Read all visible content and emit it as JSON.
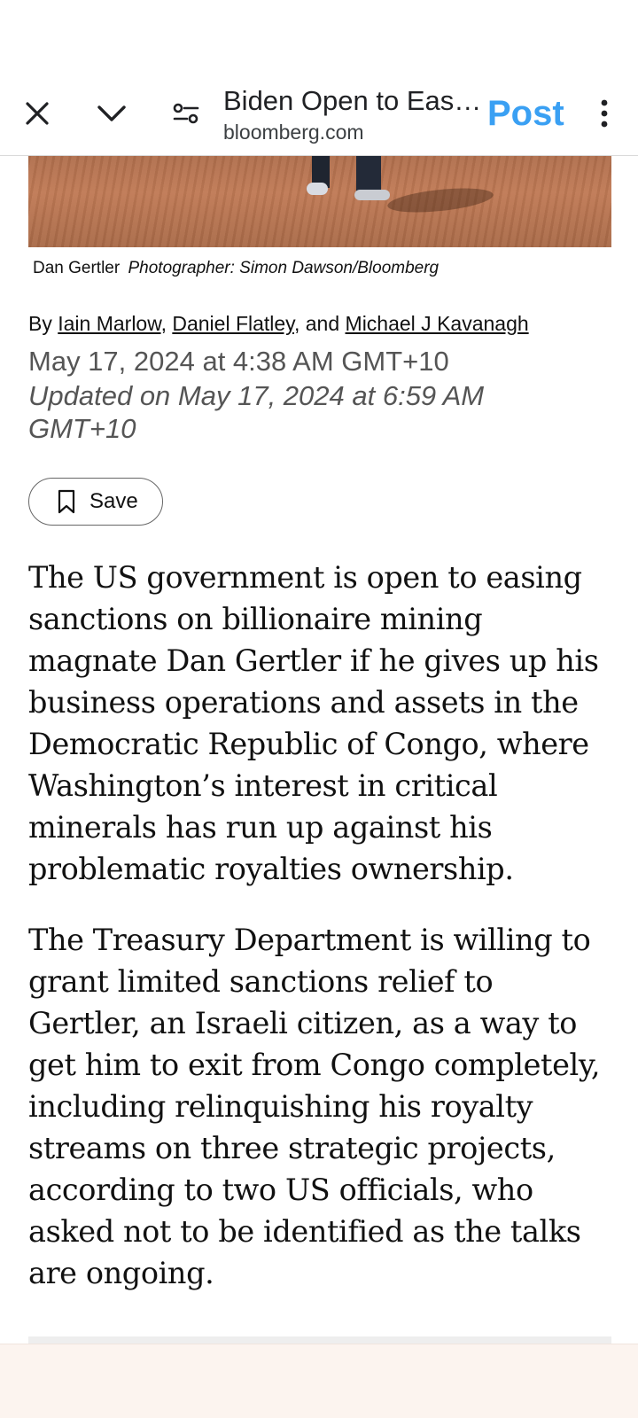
{
  "toolbar": {
    "title": "Biden Open to Easi...",
    "domain": "bloomberg.com",
    "post_label": "Post",
    "icons": [
      "close-icon",
      "chevron-down-icon",
      "page-settings-icon",
      "more-vert-icon"
    ],
    "accent_color": "#3aa0f3"
  },
  "photo": {
    "caption_name": "Dan Gertler",
    "caption_credit": "Photographer: Simon Dawson/Bloomberg"
  },
  "byline": {
    "prefix": "By",
    "authors": [
      "Iain Marlow",
      "Daniel Flatley",
      "Michael J Kavanagh"
    ],
    "sep1": ",",
    "sep2": ", and"
  },
  "dates": {
    "published": "May 17, 2024 at 4:38 AM GMT+10",
    "updated": "Updated on May 17, 2024 at 6:59 AM GMT+10"
  },
  "save_button": {
    "label": "Save",
    "icon": "bookmark-icon"
  },
  "article": {
    "paragraphs": [
      "The US government is open to easing sanctions on billionaire mining magnate Dan Gertler if he gives up his business operations and assets in the Democratic Republic of Congo, where Washington’s interest in critical minerals has run up against his problematic royalties ownership.",
      "The Treasury Department is willing to grant limited sanctions relief to Gertler, an Israeli citizen, as a way to get him to exit from Congo completely, including relinquishing his royalty streams on three strategic projects, according to two US officials, who asked not to be identified as the talks are ongoing."
    ]
  }
}
